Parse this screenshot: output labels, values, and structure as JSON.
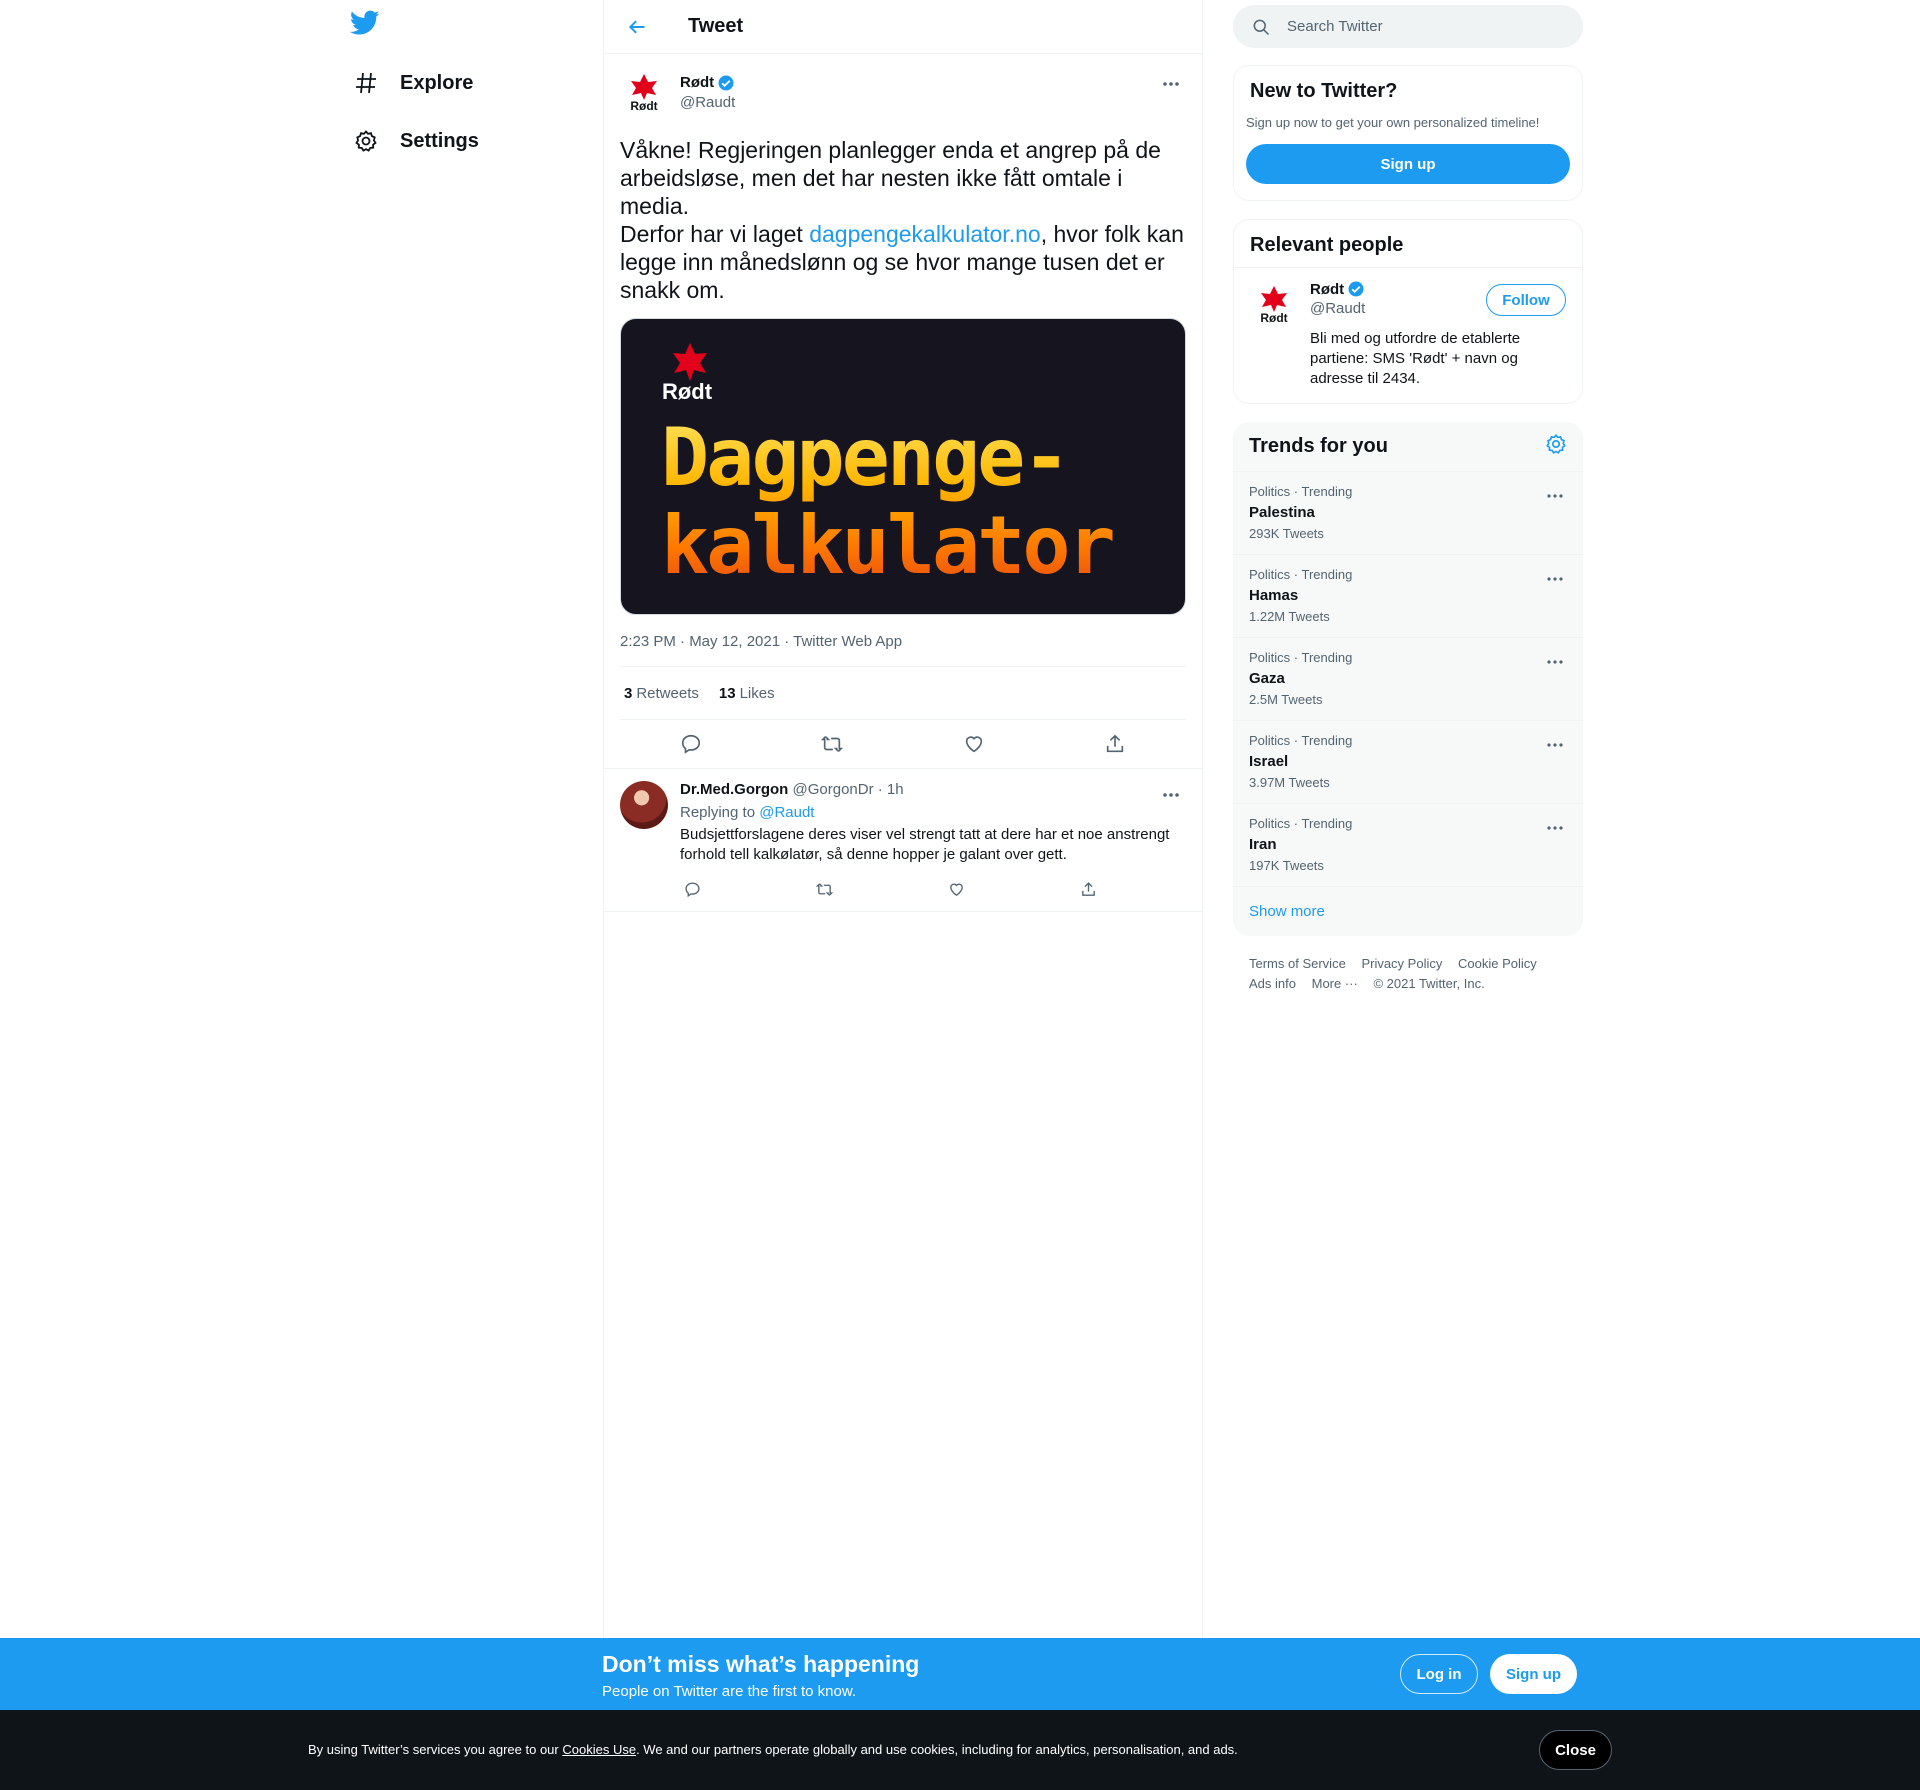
{
  "nav": {
    "items": [
      {
        "label": "Explore",
        "icon": "hashtag-icon"
      },
      {
        "label": "Settings",
        "icon": "gear-icon"
      }
    ]
  },
  "header": {
    "title": "Tweet"
  },
  "tweet": {
    "author_name": "Rødt",
    "author_handle": "@Raudt",
    "text_before_link": "Våkne! Regjeringen planlegger enda et angrep på de arbeidsløse, men det har nesten ikke fått omtale i media.\nDerfor har vi laget ",
    "link_text": "dagpengekalkulator.no",
    "text_after_link": ", hvor folk kan legge inn månedslønn og se hvor mange tusen det er snakk om.",
    "media": {
      "logo_text": "Rødt",
      "line1": "Dagpenge-",
      "line2": "kalkulator"
    },
    "meta": "2:23 PM · May 12, 2021 · Twitter Web App",
    "retweets_count": "3",
    "retweets_label": "Retweets",
    "likes_count": "13",
    "likes_label": "Likes"
  },
  "reply": {
    "name": "Dr.Med.Gorgon",
    "handle_time": "@GorgonDr · 1h",
    "replying_prefix": "Replying to",
    "replying_to": "@Raudt",
    "text": "Budsjettforslagene deres viser vel strengt tatt at dere har et noe anstrengt forhold tell kalkølatør, så denne hopper je galant over gett."
  },
  "search": {
    "placeholder": "Search Twitter"
  },
  "new_to_twitter": {
    "title": "New to Twitter?",
    "subtitle": "Sign up now to get your own personalized timeline!",
    "signup_label": "Sign up"
  },
  "relevant_people": {
    "title": "Relevant people",
    "name": "Rødt",
    "handle": "@Raudt",
    "bio": "Bli med og utfordre de etablerte partiene: SMS 'Rødt' + navn og adresse til 2434.",
    "follow_label": "Follow"
  },
  "trends": {
    "title": "Trends for you",
    "items": [
      {
        "context": "Politics · Trending",
        "name": "Palestina",
        "count": "293K Tweets"
      },
      {
        "context": "Politics · Trending",
        "name": "Hamas",
        "count": "1.22M Tweets"
      },
      {
        "context": "Politics · Trending",
        "name": "Gaza",
        "count": "2.5M Tweets"
      },
      {
        "context": "Politics · Trending",
        "name": "Israel",
        "count": "3.97M Tweets"
      },
      {
        "context": "Politics · Trending",
        "name": "Iran",
        "count": "197K Tweets"
      }
    ],
    "show_more": "Show more"
  },
  "footer": {
    "terms": "Terms of Service",
    "privacy": "Privacy Policy",
    "cookie": "Cookie Policy",
    "ads": "Ads info",
    "more": "More ···",
    "copyright": "© 2021 Twitter, Inc."
  },
  "bottom_bar": {
    "title": "Don’t miss what’s happening",
    "subtitle": "People on Twitter are the first to know.",
    "login_label": "Log in",
    "signup_label": "Sign up"
  },
  "cookie_bar": {
    "text_before": "By using Twitter’s services you agree to our ",
    "link": "Cookies Use",
    "text_after": ". We and our partners operate globally and use cookies, including for analytics, personalisation, and ads.",
    "close_label": "Close"
  },
  "colors": {
    "accent": "#1d9bf0",
    "rodt_red": "#e2001a",
    "text_secondary": "#536471"
  }
}
